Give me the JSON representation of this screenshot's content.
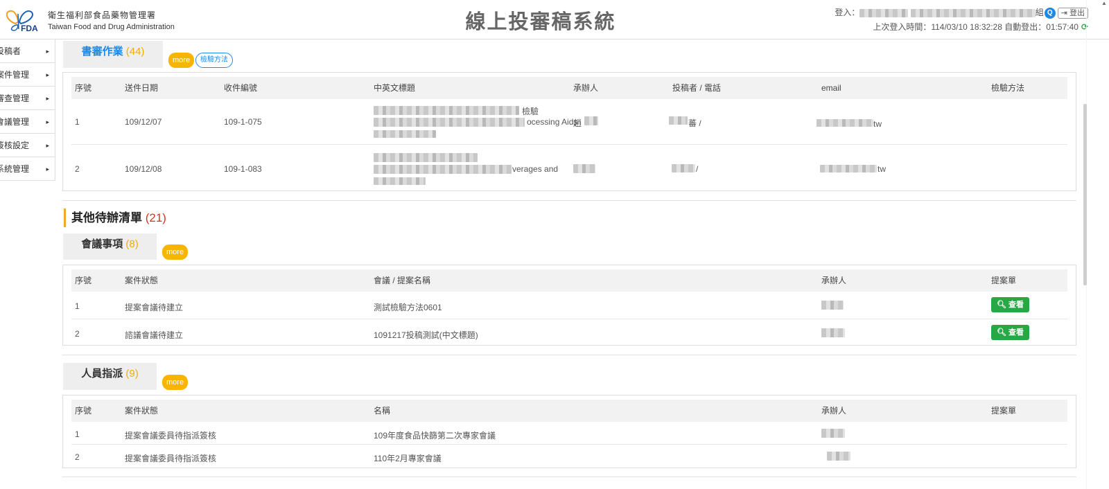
{
  "header": {
    "org_zh": "衛生福利部食品藥物管理署",
    "org_en": "Taiwan Food and Drug Administration",
    "logo_text": "FDA",
    "title": "線上投審稿系統",
    "login_prefix": "登入：",
    "login_suffix": "組",
    "q_badge": "Q",
    "logout_label": "登出",
    "last_login": "上次登入時間：114/03/10 18:32:28 自動登出：01:57:40",
    "refresh_icon": "⟳"
  },
  "sidebar": {
    "items": [
      {
        "label": "投稿者"
      },
      {
        "label": "案件管理"
      },
      {
        "label": "審查管理"
      },
      {
        "label": "會議管理"
      },
      {
        "label": "簽核設定"
      },
      {
        "label": "系統管理"
      }
    ],
    "arrow": "▸"
  },
  "review": {
    "tab_label": "書審作業",
    "count": "(44)",
    "more": "more",
    "method_btn": "檢驗方法",
    "columns": [
      "序號",
      "送件日期",
      "收件編號",
      "中英文標題",
      "承辦人",
      "投稿者 / 電話",
      "email",
      "檢驗方法"
    ],
    "rows": [
      {
        "no": "1",
        "date": "109/12/07",
        "code": "109-1-075",
        "title_tail1": "檢驗",
        "title_tail2": "ocessing Aids",
        "handler": "趙",
        "submitter": "蕃 /",
        "email_tail": "tw"
      },
      {
        "no": "2",
        "date": "109/12/08",
        "code": "109-1-083",
        "title_tail1": "",
        "title_tail2": "verages and",
        "handler": "",
        "submitter": "/",
        "email_tail": "tw"
      }
    ]
  },
  "other": {
    "title": "其他待辦清單",
    "count": "(21)"
  },
  "meeting": {
    "tab_label": "會議事項",
    "count": "(8)",
    "more": "more",
    "columns": [
      "序號",
      "案件狀態",
      "會議 / 提案名稱",
      "承辦人",
      "提案單"
    ],
    "rows": [
      {
        "no": "1",
        "status": "提案會議待建立",
        "name": "測試檢驗方法0601",
        "view": "查看"
      },
      {
        "no": "2",
        "status": "諮議會議待建立",
        "name": "1091217投稿測試(中文標題)",
        "view": "查看"
      }
    ]
  },
  "assign": {
    "tab_label": "人員指派",
    "count": "(9)",
    "more": "more",
    "columns": [
      "序號",
      "案件狀態",
      "名稱",
      "承辦人",
      "提案單"
    ],
    "rows": [
      {
        "no": "1",
        "status": "提案會議委員待指派簽核",
        "name": "109年度食品快篩第二次專家會議"
      },
      {
        "no": "2",
        "status": "提案會議委員待指派簽核",
        "name": "110年2月專家會議"
      }
    ]
  }
}
